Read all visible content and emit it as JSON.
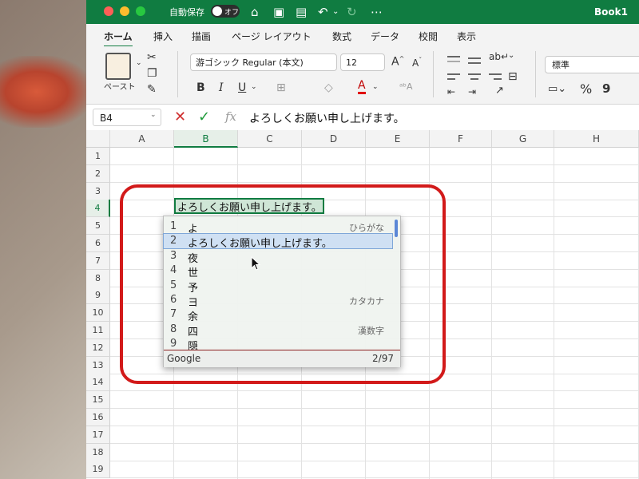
{
  "window": {
    "title": "Book1",
    "autosave_label": "自動保存",
    "autosave_state": "オフ"
  },
  "menu": {
    "tabs": [
      "ホーム",
      "挿入",
      "描画",
      "ページ レイアウト",
      "数式",
      "データ",
      "校閲",
      "表示"
    ],
    "active_tab": "ホーム"
  },
  "ribbon": {
    "paste_label": "ペースト",
    "font_name": "游ゴシック Regular (本文)",
    "font_size": "12",
    "bold": "B",
    "italic": "I",
    "underline": "U",
    "font_color_glyph": "A",
    "number_format": "標準",
    "percent": "%",
    "comma": "9"
  },
  "formula_bar": {
    "name_box": "B4",
    "formula": "よろしくお願い申し上げます。"
  },
  "sheet": {
    "columns": [
      "A",
      "B",
      "C",
      "D",
      "E",
      "F",
      "G",
      "H"
    ],
    "rows": [
      "1",
      "2",
      "3",
      "4",
      "5",
      "6",
      "7",
      "8",
      "9",
      "10",
      "11",
      "12",
      "13",
      "14",
      "15",
      "16",
      "17",
      "18",
      "19"
    ],
    "active_cell_text": "よろしくお願い申し上げます。"
  },
  "ime": {
    "candidates": [
      {
        "num": "1",
        "text": "よ",
        "annotation": "ひらがな"
      },
      {
        "num": "2",
        "text": "よろしくお願い申し上げます。",
        "annotation": ""
      },
      {
        "num": "3",
        "text": "夜",
        "annotation": ""
      },
      {
        "num": "4",
        "text": "世",
        "annotation": ""
      },
      {
        "num": "5",
        "text": "予",
        "annotation": ""
      },
      {
        "num": "6",
        "text": "ヨ",
        "annotation": "カタカナ"
      },
      {
        "num": "7",
        "text": "余",
        "annotation": ""
      },
      {
        "num": "8",
        "text": "四",
        "annotation": "漢数字"
      },
      {
        "num": "9",
        "text": "隠",
        "annotation": ""
      }
    ],
    "selected_index": 1,
    "brand": "Google",
    "page_count": "2/97"
  }
}
